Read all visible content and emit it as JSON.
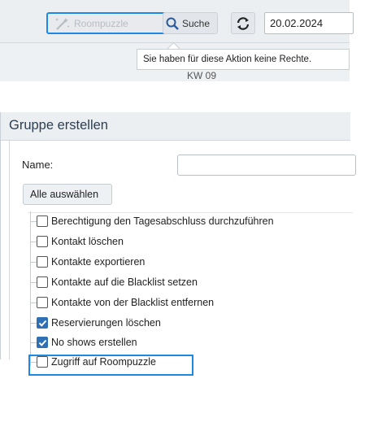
{
  "toolbar": {
    "roompuzzle_label": "Roompuzzle",
    "suche_label": "Suche",
    "date_value": "20.02.2024",
    "tooltip_text": "Sie haben für diese Aktion keine Rechte.",
    "week_label": "KW 09"
  },
  "dialog": {
    "title": "Gruppe erstellen",
    "name_label": "Name:",
    "name_value": "",
    "select_all_label": "Alle auswählen",
    "permissions": [
      {
        "label": "Berechtigung den Tagesabschluss durchzuführen",
        "checked": false
      },
      {
        "label": "Kontakt löschen",
        "checked": false
      },
      {
        "label": "Kontakte exportieren",
        "checked": false
      },
      {
        "label": "Kontakte auf die Blacklist setzen",
        "checked": false
      },
      {
        "label": "Kontakte von der Blacklist entfernen",
        "checked": false
      },
      {
        "label": "Reservierungen löschen",
        "checked": true
      },
      {
        "label": "No shows erstellen",
        "checked": true
      },
      {
        "label": "Zugriff auf Roompuzzle",
        "checked": false
      }
    ]
  },
  "colors": {
    "accent": "#1e88e5",
    "checkbox_checked": "#2f6fb3",
    "header_bg": "#eceff2"
  }
}
